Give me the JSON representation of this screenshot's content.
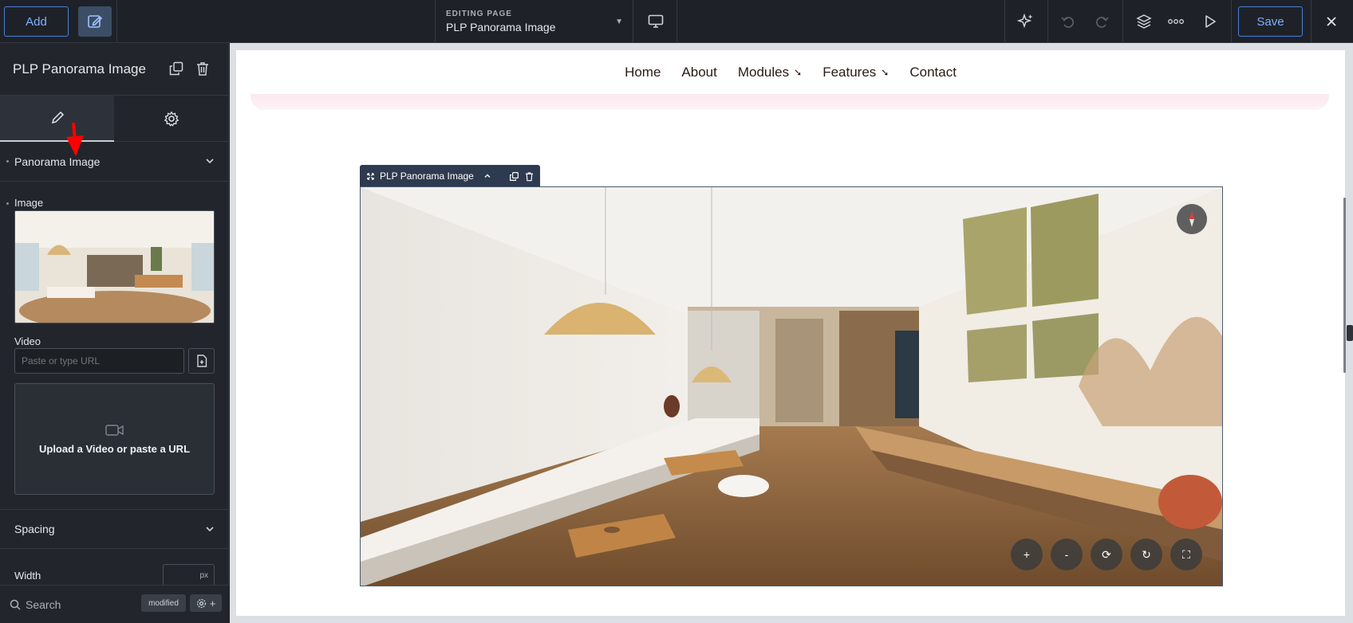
{
  "topbar": {
    "add_label": "Add",
    "editing_label": "EDITING PAGE",
    "page_name": "PLP Panorama Image",
    "save_label": "Save"
  },
  "panel": {
    "title": "PLP Panorama Image",
    "sections": {
      "panorama": "Panorama Image",
      "spacing": "Spacing"
    },
    "image_label": "Image",
    "video_label": "Video",
    "video_placeholder": "Paste or type URL",
    "upload_text": "Upload a Video or paste a URL",
    "width_label": "Width",
    "width_unit": "px",
    "search_placeholder": "Search",
    "modified_badge": "modified"
  },
  "site_nav": {
    "items": [
      {
        "label": "Home"
      },
      {
        "label": "About"
      },
      {
        "label": "Modules",
        "submenu": "➘"
      },
      {
        "label": "Features",
        "submenu": "➘"
      },
      {
        "label": "Contact"
      }
    ]
  },
  "widget": {
    "label": "PLP Panorama Image"
  },
  "pano_controls": [
    "+",
    "-",
    "⟳",
    "↻",
    "⛶"
  ],
  "colors": {
    "accent": "#4a7fd6",
    "panel_bg": "#22262c",
    "topbar_bg": "#1e2228",
    "widget_label_bg": "#2e3a4f",
    "arrow": "#ff0000"
  }
}
